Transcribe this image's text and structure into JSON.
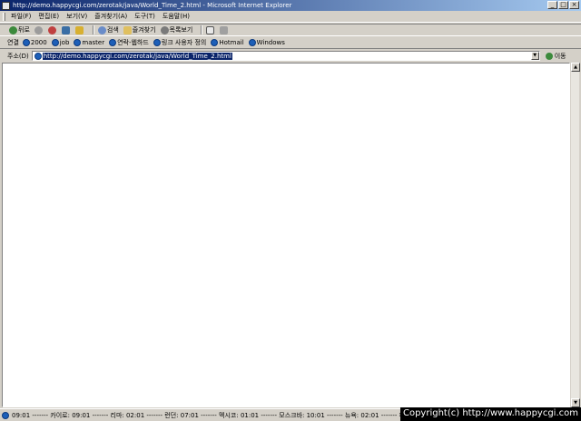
{
  "window": {
    "title": "http://demo.happycgi.com/zerotak/java/World_Time_2.html - Microsoft Internet Explorer",
    "controls": [
      "_",
      "□",
      "×"
    ]
  },
  "menubar": {
    "items": [
      "파일(F)",
      "편집(E)",
      "보기(V)",
      "즐겨찾기(A)",
      "도구(T)",
      "도움말(H)"
    ]
  },
  "toolbar": {
    "back": "뒤로",
    "search": "검색",
    "favorites": "즐겨찾기",
    "history": "목록보기"
  },
  "links": {
    "label": "연결",
    "items": [
      "2000",
      "job",
      "master",
      "연락-웹하드",
      "링크 사용자 정의",
      "Hotmail",
      "Windows"
    ]
  },
  "address": {
    "label": "주소(D)",
    "url": "http://demo.happycgi.com/zerotak/java/World_Time_2.html",
    "go": "이동"
  },
  "status": {
    "text": "09:01 ------- 카이로: 09:01 ------- 리마: 02:01 ------- 런던: 07:01 ------- 멕시코: 01:01 ------- 모스크바: 10:01 ------- 뉴욕: 02:01 ------- 파"
  },
  "watermark": {
    "text": "Copyright(c) http://www.happycgi.com"
  }
}
